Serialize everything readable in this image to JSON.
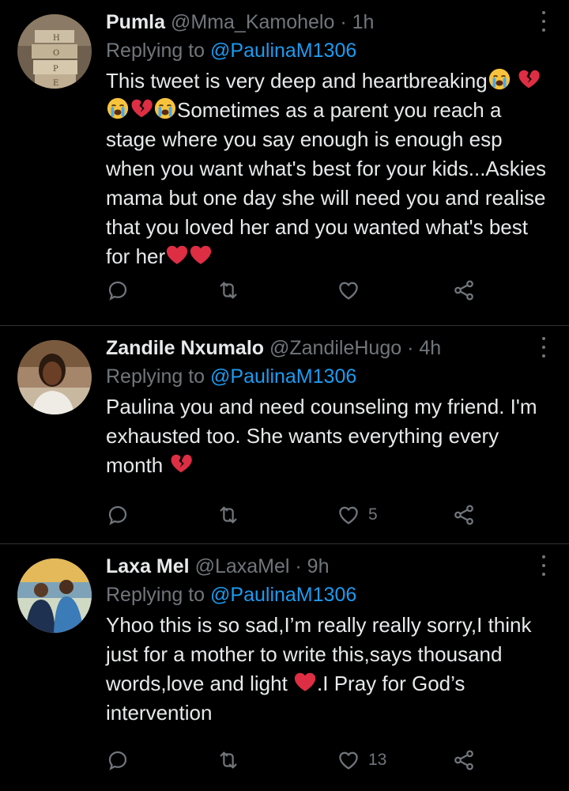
{
  "tweets": [
    {
      "name": "Pumla",
      "handle": "@Mma_Kamohelo",
      "time": "· 1h",
      "replying_label": "Replying to",
      "replying_to": "@PaulinaM1306",
      "text_1": "This tweet is very deep and heartbreaking",
      "text_2": "Sometimes as a parent you reach a stage where you say enough is enough esp when you want what's best for your kids...Askies mama but one day she will need you and realise that you loved her and you wanted what's best for her",
      "likes": ""
    },
    {
      "name": "Zandile Nxumalo",
      "handle": "@ZandileHugo",
      "time": "· 4h",
      "replying_label": "Replying to",
      "replying_to": "@PaulinaM1306",
      "text_1": "Paulina you and need counseling my friend. I'm exhausted too. She wants everything every month",
      "likes": "5"
    },
    {
      "name": "Laxa Mel",
      "handle": "@LaxaMel",
      "time": "· 9h",
      "replying_label": "Replying to",
      "replying_to": "@PaulinaM1306",
      "text_1": "Yhoo this is so sad,I’m really really sorry,I think just for a mother to write this,says thousand words,love and light",
      "text_2": ".I Pray for God’s intervention",
      "likes": "13"
    }
  ],
  "icons": {
    "reply": "reply-icon",
    "retweet": "retweet-icon",
    "like": "heart-icon",
    "share": "share-icon",
    "more": "more-options-icon"
  },
  "colors": {
    "background": "#000000",
    "text": "#e7e9ea",
    "muted": "#71767b",
    "link": "#1d9bf0",
    "divider": "#2f3336"
  }
}
